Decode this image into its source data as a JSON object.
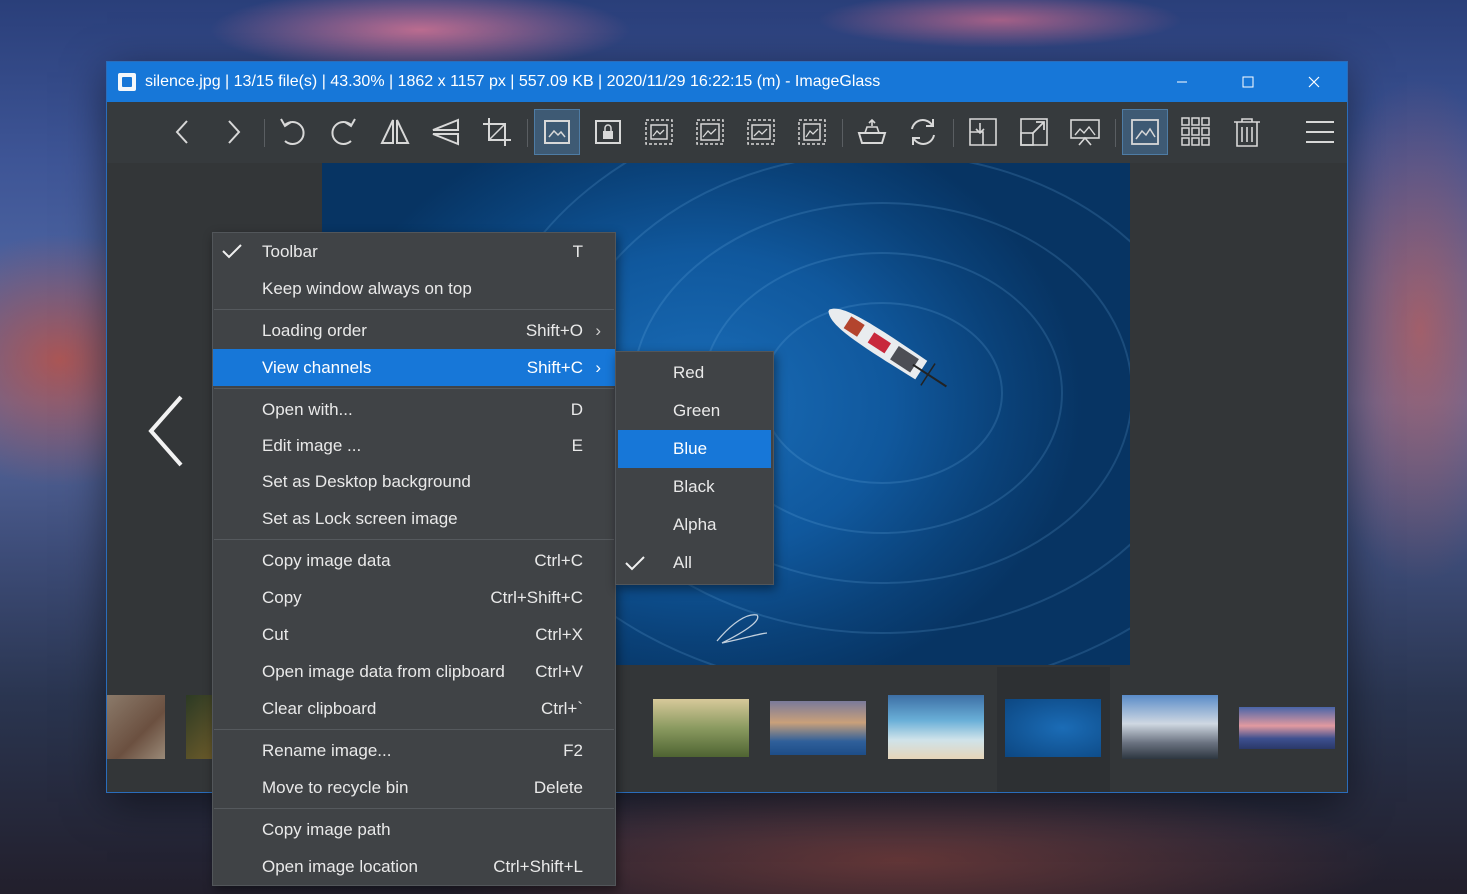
{
  "window": {
    "title": "silence.jpg  |  13/15 file(s)  |  43.30%  |  1862 x 1157 px  |  557.09 KB  |  2020/11/29 16:22:15 (m)  - ImageGlass",
    "controls": {
      "minimize": "minimize-icon",
      "maximize": "maximize-icon",
      "close": "close-icon"
    }
  },
  "toolbar": {
    "buttons": [
      "previous-image",
      "next-image",
      "rotate-left",
      "rotate-right",
      "flip-horizontal",
      "flip-vertical",
      "crop",
      "auto-zoom",
      "lock-zoom",
      "scale-to-width",
      "scale-to-height",
      "scale-to-fit",
      "scale-to-fill",
      "open-with",
      "refresh",
      "goto-first",
      "full-screen",
      "slideshow",
      "toggle-thumbnails",
      "thumbnail-grid",
      "delete",
      "main-menu"
    ],
    "active": [
      "auto-zoom",
      "toggle-thumbnails"
    ]
  },
  "context_menu": {
    "items": [
      {
        "label": "Toolbar",
        "shortcut": "T",
        "checked": true
      },
      {
        "label": "Keep window always on top",
        "shortcut": ""
      },
      {
        "label": "Loading order",
        "shortcut": "Shift+O",
        "submenu": true
      },
      {
        "label": "View channels",
        "shortcut": "Shift+C",
        "submenu": true,
        "highlighted": true
      },
      {
        "label": "Open with...",
        "shortcut": "D"
      },
      {
        "label": "Edit image ...",
        "shortcut": "E"
      },
      {
        "label": "Set as Desktop background",
        "shortcut": ""
      },
      {
        "label": "Set as Lock screen image",
        "shortcut": ""
      },
      {
        "label": "Copy image data",
        "shortcut": "Ctrl+C"
      },
      {
        "label": "Copy",
        "shortcut": "Ctrl+Shift+C"
      },
      {
        "label": "Cut",
        "shortcut": "Ctrl+X"
      },
      {
        "label": "Open image data from clipboard",
        "shortcut": "Ctrl+V"
      },
      {
        "label": "Clear clipboard",
        "shortcut": "Ctrl+`"
      },
      {
        "label": "Rename image...",
        "shortcut": "F2"
      },
      {
        "label": "Move to recycle bin",
        "shortcut": "Delete"
      },
      {
        "label": "Copy image path",
        "shortcut": ""
      },
      {
        "label": "Open image location",
        "shortcut": "Ctrl+Shift+L"
      }
    ]
  },
  "channels_submenu": {
    "items": [
      {
        "label": "Red"
      },
      {
        "label": "Green"
      },
      {
        "label": "Blue",
        "highlighted": true
      },
      {
        "label": "Black"
      },
      {
        "label": "Alpha"
      },
      {
        "label": "All",
        "checked": true
      }
    ]
  },
  "thumbnails": {
    "items": [
      "highland-cow",
      "dark-forest",
      "misty-pine-forest",
      "sunset-lake",
      "people-on-beach",
      "boat-on-blue-sea",
      "snowy-mountains",
      "pink-sky-mountains"
    ],
    "selected": "boat-on-blue-sea"
  },
  "colors": {
    "accent": "#1777d8",
    "menu_bg": "#404346",
    "window_bg": "#333638"
  }
}
